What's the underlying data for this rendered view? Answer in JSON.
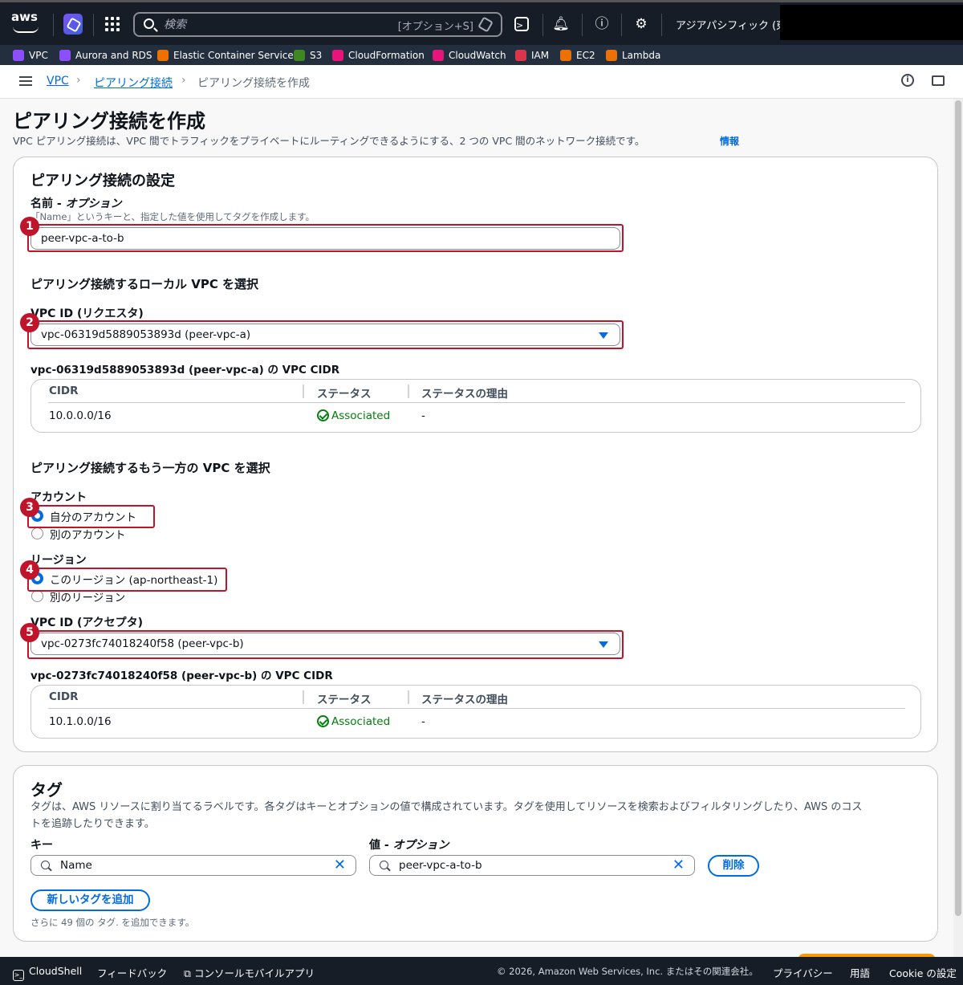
{
  "topnav": {
    "search_placeholder": "検索",
    "search_shortcut": "[オプション+S]",
    "region": "アジアパシフィック (東京)"
  },
  "favorites": [
    {
      "label": "VPC",
      "color": "#8c4fff"
    },
    {
      "label": "Aurora and RDS",
      "color": "#8c4fff"
    },
    {
      "label": "Elastic Container Service",
      "color": "#ed7100"
    },
    {
      "label": "S3",
      "color": "#3f8624"
    },
    {
      "label": "CloudFormation",
      "color": "#e7157b"
    },
    {
      "label": "CloudWatch",
      "color": "#e7157b"
    },
    {
      "label": "IAM",
      "color": "#dd344c"
    },
    {
      "label": "EC2",
      "color": "#ed7100"
    },
    {
      "label": "Lambda",
      "color": "#ed7100"
    }
  ],
  "breadcrumb": {
    "vpc": "VPC",
    "peering": "ピアリング接続",
    "current": "ピアリング接続を作成"
  },
  "page": {
    "title": "ピアリング接続を作成",
    "description": "VPC ピアリング接続は、VPC 間でトラフィックをプライベートにルーティングできるようにする、2 つの VPC 間のネットワーク接続です。",
    "info_link": "情報"
  },
  "settings": {
    "heading": "ピアリング接続の設定",
    "name_label": "名前 - ",
    "name_optional": "オプション",
    "name_hint": "「Name」というキーと、指定した値を使用してタグを作成します。",
    "name_value": "peer-vpc-a-to-b",
    "local_heading": "ピアリング接続するローカル VPC を選択",
    "requester_label": "VPC ID (リクエスタ)",
    "requester_value": "vpc-06319d5889053893d (peer-vpc-a)",
    "requester_cidr_heading": "vpc-06319d5889053893d (peer-vpc-a) の VPC CIDR",
    "other_heading": "ピアリング接続するもう一方の VPC を選択",
    "account_label": "アカウント",
    "account_options": [
      "自分のアカウント",
      "別のアカウント"
    ],
    "region_label": "リージョン",
    "region_options": [
      "このリージョン (ap-northeast-1)",
      "別のリージョン"
    ],
    "accepter_label": "VPC ID (アクセプタ)",
    "accepter_value": "vpc-0273fc74018240f58 (peer-vpc-b)",
    "accepter_cidr_heading": "vpc-0273fc74018240f58 (peer-vpc-b) の VPC CIDR"
  },
  "cidr_table": {
    "headers": [
      "CIDR",
      "ステータス",
      "ステータスの理由"
    ],
    "requester_row": {
      "cidr": "10.0.0.0/16",
      "status": "Associated",
      "reason": "-"
    },
    "accepter_row": {
      "cidr": "10.1.0.0/16",
      "status": "Associated",
      "reason": "-"
    }
  },
  "annotations": [
    "1",
    "2",
    "3",
    "4",
    "5"
  ],
  "tags": {
    "heading": "タグ",
    "description_line1": "タグは、AWS リソースに割り当てるラベルです。各タグはキーとオプションの値で構成されています。タグを使用してリソースを検索およびフィルタリングしたり、AWS のコス",
    "description_line2": "トを追跡したりできます。",
    "key_label": "キー",
    "value_label": "値 - ",
    "value_optional": "オプション",
    "key_value": "Name",
    "value_value": "peer-vpc-a-to-b",
    "remove_button": "削除",
    "add_button": "新しいタグを追加",
    "remaining_hint": "さらに 49 個の タグ. を追加できます。"
  },
  "footer": {
    "cloudshell": "CloudShell",
    "feedback": "フィードバック",
    "mobile_app": "コンソールモバイルアプリ",
    "copyright": "© 2026, Amazon Web Services, Inc. またはその関連会社。",
    "privacy": "プライバシー",
    "terms": "用語",
    "cookie": "Cookie の設定"
  }
}
